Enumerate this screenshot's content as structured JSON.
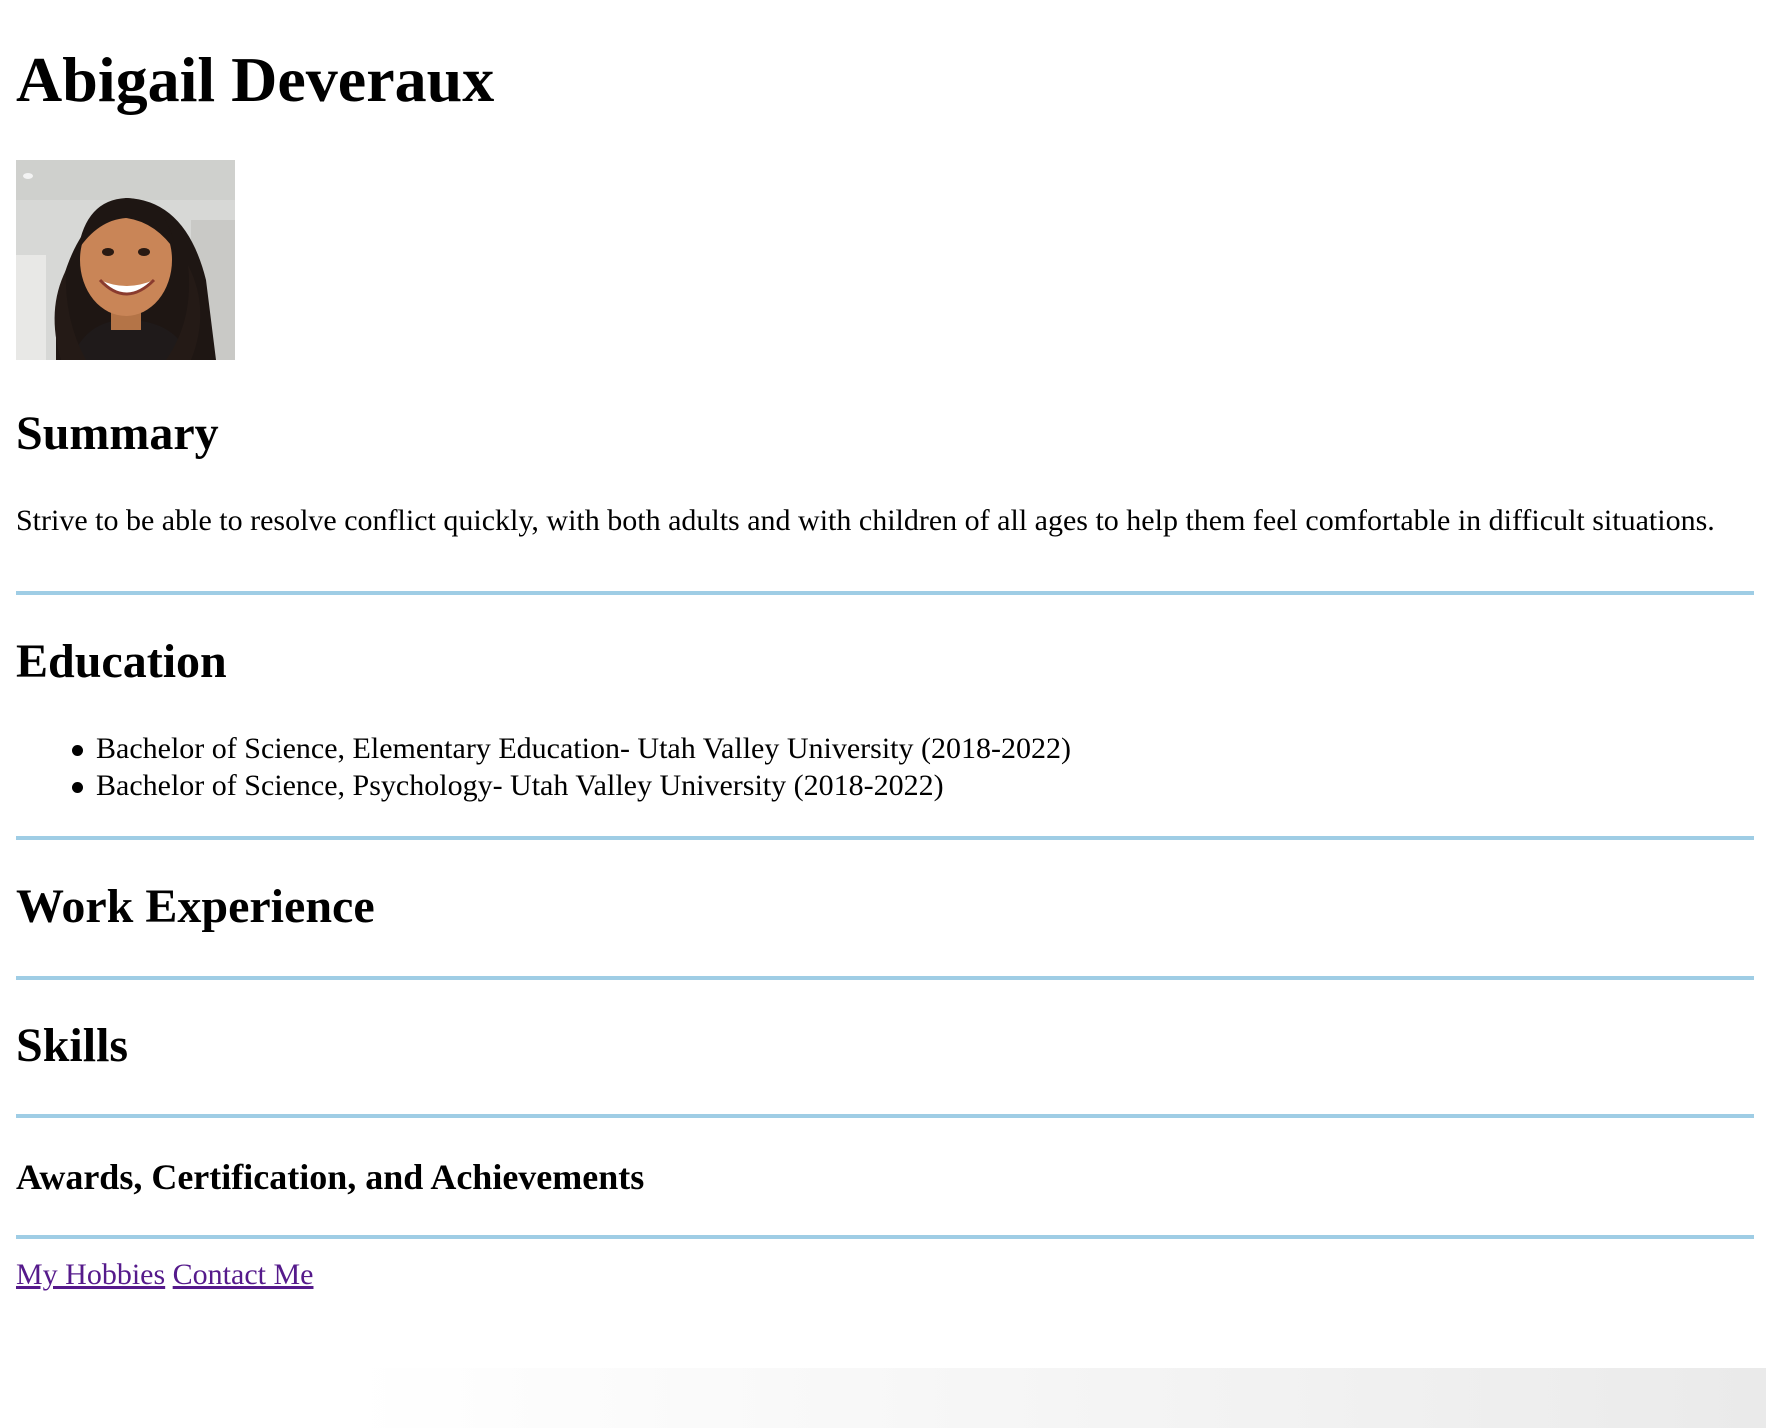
{
  "header": {
    "name": "Abigail Deveraux"
  },
  "photo": {
    "alt": "Portrait photo of Abigail Deveraux",
    "skin_color": "#c98557",
    "hair_color": "#1e1613",
    "background_color": "#d7d8d6",
    "shirt_color": "#1f1a1a"
  },
  "summary": {
    "title": "Summary",
    "text": "Strive to be able to resolve conflict quickly, with both adults and with children of all ages to help them feel comfortable in difficult situations."
  },
  "education": {
    "title": "Education",
    "items": [
      "Bachelor of Science, Elementary Education- Utah Valley University (2018-2022)",
      "Bachelor of Science, Psychology- Utah Valley University (2018-2022)"
    ]
  },
  "work_experience": {
    "title": "Work Experience"
  },
  "skills": {
    "title": "Skills"
  },
  "awards": {
    "title": "Awards, Certification, and Achievements"
  },
  "links": {
    "hobbies": "My Hobbies",
    "contact": "Contact Me"
  },
  "colors": {
    "rule": "#9fcde5",
    "visited_link": "#551a8b"
  }
}
